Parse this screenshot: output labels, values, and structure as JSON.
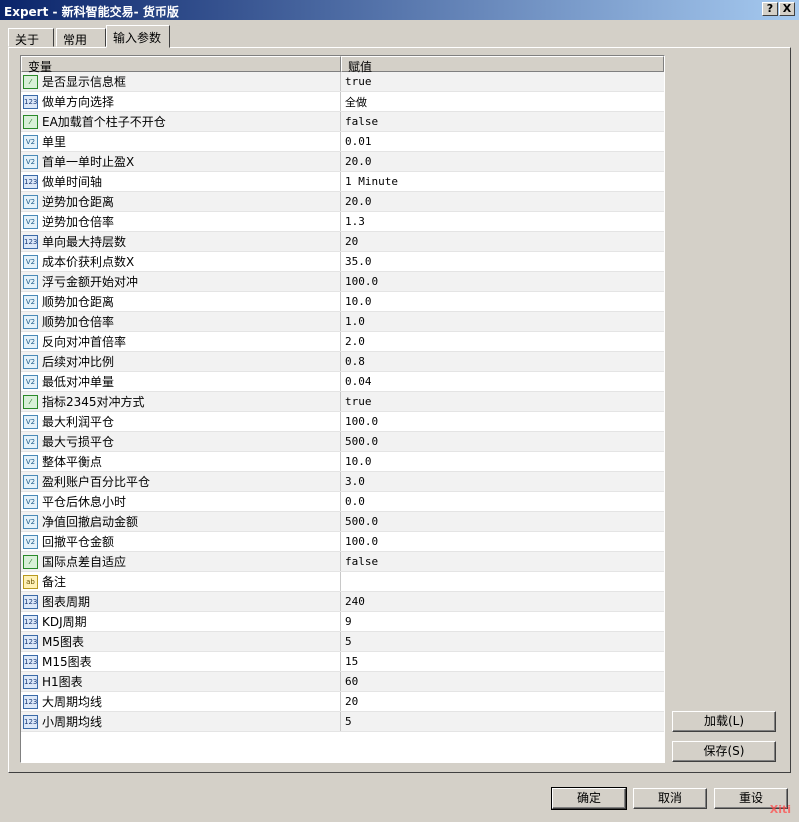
{
  "window": {
    "title": "Expert - 新科智能交易- 货币版",
    "help_label": "?",
    "close_label": "X"
  },
  "tabs": [
    {
      "label": "关于"
    },
    {
      "label": "常用"
    },
    {
      "label": "输入参数"
    }
  ],
  "table": {
    "headers": [
      "变量",
      "赋值"
    ],
    "rows": [
      {
        "icon": "bool",
        "name": "是否显示信息框",
        "value": "true"
      },
      {
        "icon": "int",
        "name": "做单方向选择",
        "value": "全做"
      },
      {
        "icon": "bool",
        "name": "EA加载首个柱子不开仓",
        "value": "false"
      },
      {
        "icon": "dbl",
        "name": "单里",
        "value": "0.01"
      },
      {
        "icon": "dbl",
        "name": "首单一单时止盈X",
        "value": "20.0"
      },
      {
        "icon": "int",
        "name": "做单时间轴",
        "value": "1 Minute"
      },
      {
        "icon": "dbl",
        "name": "逆势加仓距离",
        "value": "20.0"
      },
      {
        "icon": "dbl",
        "name": "逆势加仓倍率",
        "value": "1.3"
      },
      {
        "icon": "int",
        "name": "单向最大持层数",
        "value": "20"
      },
      {
        "icon": "dbl",
        "name": "成本价获利点数X",
        "value": "35.0"
      },
      {
        "icon": "dbl",
        "name": "浮亏金额开始对冲",
        "value": "100.0"
      },
      {
        "icon": "dbl",
        "name": "顺势加仓距离",
        "value": "10.0"
      },
      {
        "icon": "dbl",
        "name": "顺势加仓倍率",
        "value": "1.0"
      },
      {
        "icon": "dbl",
        "name": "反向对冲首倍率",
        "value": "2.0"
      },
      {
        "icon": "dbl",
        "name": "后续对冲比例",
        "value": "0.8"
      },
      {
        "icon": "dbl",
        "name": "最低对冲单量",
        "value": "0.04"
      },
      {
        "icon": "bool",
        "name": "指标2345对冲方式",
        "value": "true"
      },
      {
        "icon": "dbl",
        "name": "最大利润平仓",
        "value": "100.0"
      },
      {
        "icon": "dbl",
        "name": "最大亏损平仓",
        "value": "500.0"
      },
      {
        "icon": "dbl",
        "name": "整体平衡点",
        "value": "10.0"
      },
      {
        "icon": "dbl",
        "name": "盈利账户百分比平仓",
        "value": "3.0"
      },
      {
        "icon": "dbl",
        "name": "平仓后休息小时",
        "value": "0.0"
      },
      {
        "icon": "dbl",
        "name": "净值回撤启动金额",
        "value": "500.0"
      },
      {
        "icon": "dbl",
        "name": "回撤平仓金额",
        "value": "100.0"
      },
      {
        "icon": "bool",
        "name": "国际点差自适应",
        "value": "false"
      },
      {
        "icon": "str",
        "name": "备注",
        "value": ""
      },
      {
        "icon": "int",
        "name": "图表周期",
        "value": "240"
      },
      {
        "icon": "int",
        "name": "KDJ周期",
        "value": "9"
      },
      {
        "icon": "int",
        "name": "M5图表",
        "value": "5"
      },
      {
        "icon": "int",
        "name": "M15图表",
        "value": "15"
      },
      {
        "icon": "int",
        "name": "H1图表",
        "value": "60"
      },
      {
        "icon": "int",
        "name": "大周期均线",
        "value": "20"
      },
      {
        "icon": "int",
        "name": "小周期均线",
        "value": "5"
      }
    ]
  },
  "icon_glyphs": {
    "bool": "⁄",
    "int": "123",
    "dbl": "V2",
    "str": "ab"
  },
  "side_buttons": {
    "load": "加载(L)",
    "save": "保存(S)"
  },
  "footer_buttons": {
    "ok": "确定",
    "cancel": "取消",
    "reset": "重设"
  },
  "watermark": "Xiti"
}
